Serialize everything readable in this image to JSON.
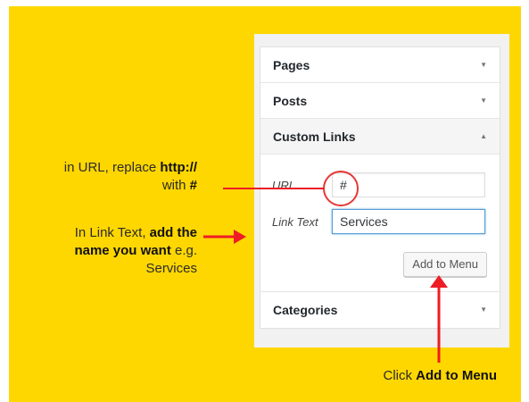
{
  "accordion": {
    "pages": {
      "label": "Pages",
      "arrow": "▼"
    },
    "posts": {
      "label": "Posts",
      "arrow": "▼"
    },
    "custom_links": {
      "label": "Custom Links",
      "arrow": "▲",
      "url_label": "URL",
      "url_value": "#",
      "link_text_label": "Link Text",
      "link_text_value": "Services",
      "add_button": "Add to Menu"
    },
    "categories": {
      "label": "Categories",
      "arrow": "▼"
    }
  },
  "annotations": {
    "url": {
      "line1": "in URL, replace ",
      "line1_bold": "http://",
      "line2": "with ",
      "line2_bold": "#"
    },
    "link_text": {
      "line1": "In Link Text, ",
      "line1_bold": "add the",
      "line2_bold": "name you want",
      "line2": " e.g.",
      "line3": "Services"
    },
    "click": {
      "prefix": "Click ",
      "bold": "Add to Menu"
    }
  },
  "colors": {
    "background": "#ffd700",
    "annotation_red": "#ee1c25",
    "focus_blue": "#5b9dd9"
  }
}
